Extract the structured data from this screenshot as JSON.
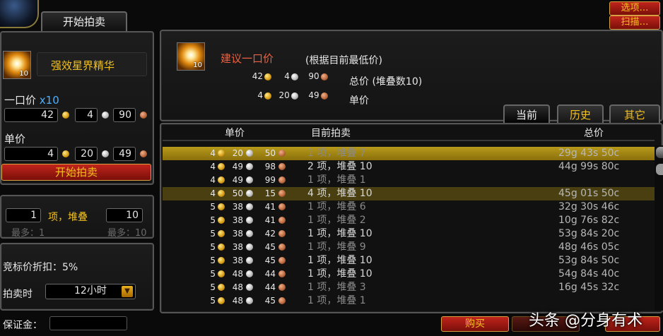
{
  "window": {
    "tab_title": "开始拍卖"
  },
  "top_buttons": {
    "options": "选项…",
    "scan": "扫描…"
  },
  "left": {
    "item_name": "强效星界精华",
    "item_count": "10",
    "buyout_label": "一口价",
    "buyout_mult": "x10",
    "buyout": {
      "gold": "42",
      "silver": "4",
      "copper": "90"
    },
    "unit_label": "单价",
    "unit": {
      "gold": "4",
      "silver": "20",
      "copper": "49"
    },
    "start_button": "开始拍卖",
    "stacks_count": "1",
    "stacks_label": "项，堆叠",
    "stack_size": "10",
    "max_stacks": "最多：1",
    "max_stack_size": "最多：10",
    "bid_discount": "竞标价折扣：5%",
    "duration_label": "拍卖时",
    "duration_value": "12小时",
    "deposit_label": "保证金："
  },
  "suggest": {
    "title": "建议一口价",
    "note": "(根据目前最低价)",
    "item_count": "10",
    "total": {
      "gold": "42",
      "silver": "4",
      "copper": "90"
    },
    "total_label": "总价 (堆叠数10)",
    "unit": {
      "gold": "4",
      "silver": "20",
      "copper": "49"
    },
    "unit_label": "单价"
  },
  "tabs": {
    "current": "当前",
    "history": "历史",
    "other": "其它"
  },
  "list": {
    "headers": {
      "unit": "单价",
      "current": "目前拍卖",
      "total": "总价"
    },
    "rows": [
      {
        "g": "4",
        "s": "20",
        "c": "50",
        "cur": "1 项，堆叠 7",
        "tot": "29g 43s 50c",
        "state": "sel",
        "dim": true
      },
      {
        "g": "4",
        "s": "49",
        "c": "98",
        "cur": "2 项，堆叠 10",
        "tot": "44g 99s 80c",
        "state": "",
        "dim": false
      },
      {
        "g": "4",
        "s": "49",
        "c": "99",
        "cur": "1 项，堆叠 1",
        "tot": "",
        "state": "",
        "dim": true
      },
      {
        "g": "4",
        "s": "50",
        "c": "15",
        "cur": "4 项，堆叠 10",
        "tot": "45g 01s 50c",
        "state": "sel2",
        "dim": false
      },
      {
        "g": "5",
        "s": "38",
        "c": "41",
        "cur": "1 项，堆叠 6",
        "tot": "32g 30s 46c",
        "state": "",
        "dim": true
      },
      {
        "g": "5",
        "s": "38",
        "c": "41",
        "cur": "1 项，堆叠 2",
        "tot": "10g 76s 82c",
        "state": "",
        "dim": true
      },
      {
        "g": "5",
        "s": "38",
        "c": "42",
        "cur": "1 项，堆叠 10",
        "tot": "53g 84s 20c",
        "state": "",
        "dim": false
      },
      {
        "g": "5",
        "s": "38",
        "c": "45",
        "cur": "1 项，堆叠 9",
        "tot": "48g 46s 05c",
        "state": "",
        "dim": true
      },
      {
        "g": "5",
        "s": "38",
        "c": "45",
        "cur": "1 项，堆叠 10",
        "tot": "53g 84s 50c",
        "state": "",
        "dim": false
      },
      {
        "g": "5",
        "s": "48",
        "c": "44",
        "cur": "1 项，堆叠 10",
        "tot": "54g 84s 40c",
        "state": "",
        "dim": false
      },
      {
        "g": "5",
        "s": "48",
        "c": "44",
        "cur": "1 项，堆叠 3",
        "tot": "16g 45s 32c",
        "state": "",
        "dim": true
      },
      {
        "g": "5",
        "s": "48",
        "c": "45",
        "cur": "1 项，堆叠 1",
        "tot": "",
        "state": "",
        "dim": true
      }
    ]
  },
  "bottom": {
    "buy": "购买",
    "watermark": "头条 @分身有术"
  }
}
